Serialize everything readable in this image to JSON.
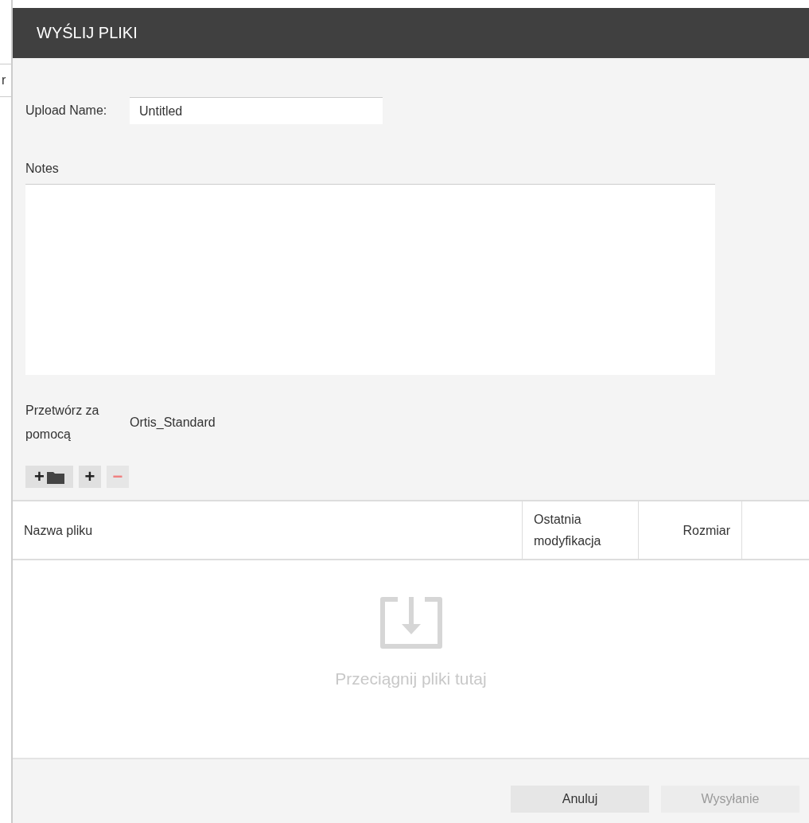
{
  "background": {
    "cut_text": "r"
  },
  "dialog": {
    "title": "WYŚLIJ PLIKI"
  },
  "upload_name": {
    "label": "Upload Name:",
    "value": "Untitled"
  },
  "notes": {
    "label": "Notes"
  },
  "process_with": {
    "label": "Przetwórz za pomocą",
    "value": "Ortis_Standard"
  },
  "toolbar": [
    {
      "kind": "add-folder",
      "text": "+",
      "disabled": false
    },
    {
      "kind": "add",
      "text": "+",
      "disabled": false
    },
    {
      "kind": "remove",
      "text": "−",
      "disabled": true
    }
  ],
  "table": {
    "columns": [
      {
        "label": "Nazwa pliku",
        "kind": "text"
      },
      {
        "label": "Ostatnia modyfikacja",
        "kind": "text"
      },
      {
        "label": "Rozmiar",
        "kind": "number"
      }
    ],
    "empty_text": "Przeciągnij pliki tutaj"
  },
  "buttons": [
    {
      "label": "Anuluj",
      "disabled": false
    },
    {
      "label": "Wysyłanie",
      "disabled": true
    }
  ]
}
